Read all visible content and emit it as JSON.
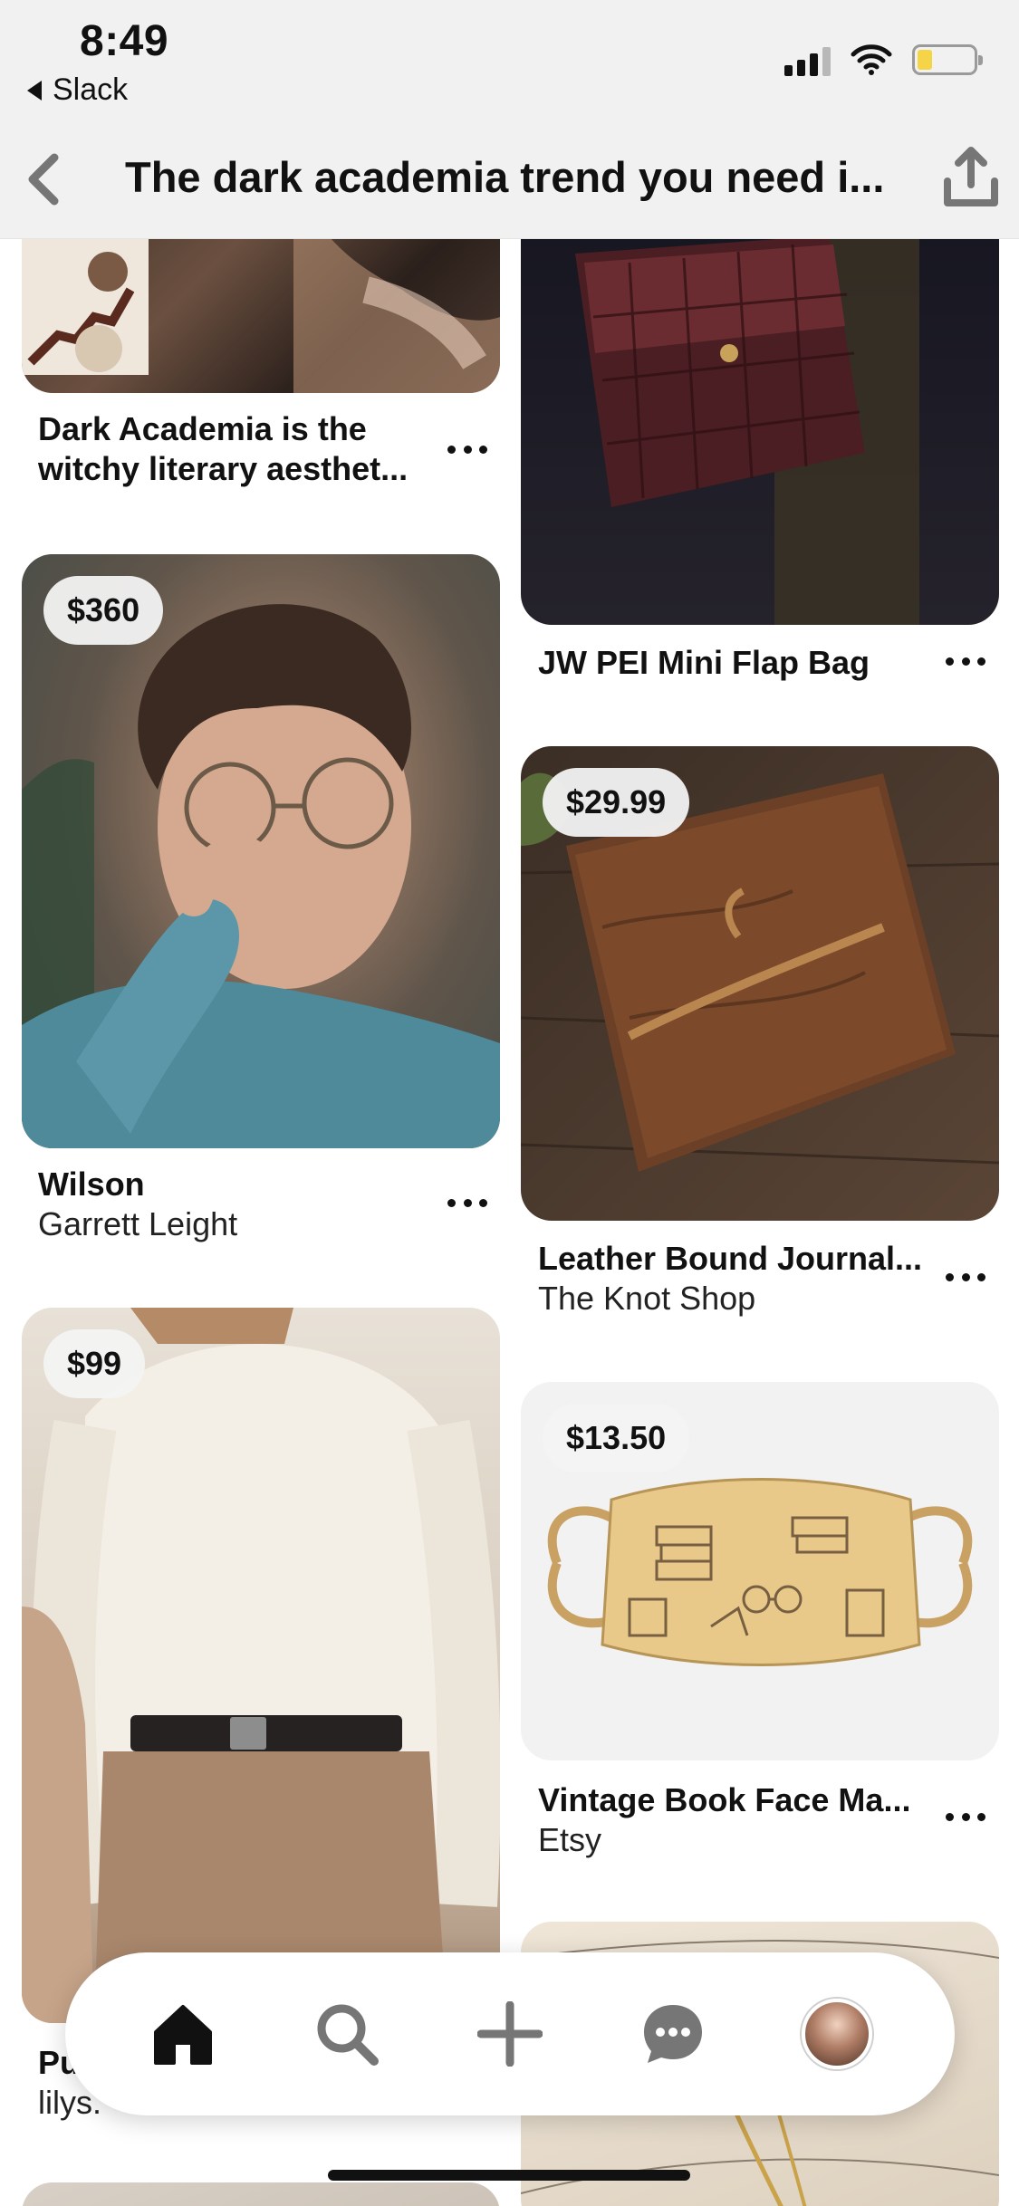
{
  "status_bar": {
    "time": "8:49",
    "back_app": "Slack"
  },
  "header": {
    "title": "The dark academia trend you need i..."
  },
  "pins": [
    {
      "id": "dark-academia",
      "title": "Dark Academia is the",
      "title_line2": "witchy literary aesthet...",
      "subtitle": "",
      "price": ""
    },
    {
      "id": "jw-pei",
      "title": "JW PEI Mini Flap Bag",
      "subtitle": "",
      "price": ""
    },
    {
      "id": "wilson",
      "title": "Wilson",
      "subtitle": "Garrett Leight",
      "price": "$360"
    },
    {
      "id": "journal",
      "title": "Leather Bound Journal...",
      "subtitle": "The Knot Shop",
      "price": "$29.99"
    },
    {
      "id": "sweater",
      "title": "Pu",
      "subtitle": "lilys.",
      "price": "$99"
    },
    {
      "id": "facemask",
      "title": "Vintage Book Face Ma...",
      "subtitle": "Etsy",
      "price": "$13.50"
    }
  ],
  "tabbar": {
    "items": [
      {
        "name": "home",
        "icon": "home-icon",
        "active": true
      },
      {
        "name": "search",
        "icon": "search-icon",
        "active": false
      },
      {
        "name": "create",
        "icon": "plus-icon",
        "active": false
      },
      {
        "name": "messages",
        "icon": "chat-icon",
        "active": false
      },
      {
        "name": "profile",
        "icon": "avatar",
        "active": false
      }
    ]
  },
  "colors": {
    "header_bg": "#f1f1f1",
    "price_pill": "#f3f3f3",
    "text": "#111111",
    "icon_gray": "#767676"
  }
}
